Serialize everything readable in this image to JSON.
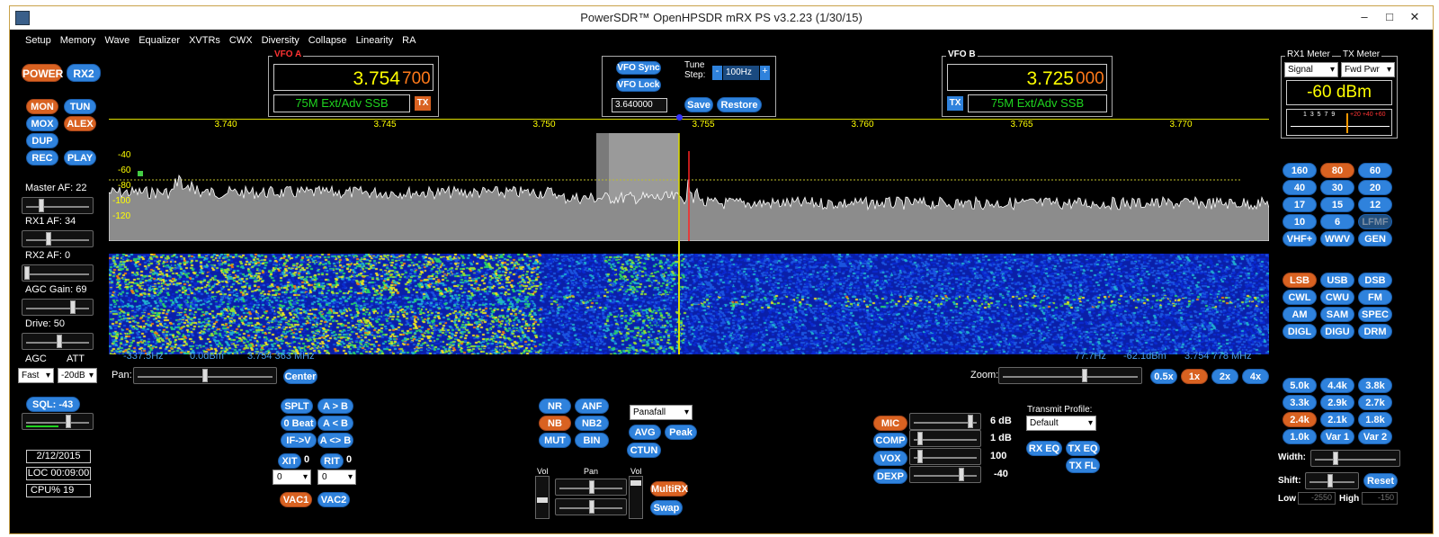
{
  "window": {
    "title": "PowerSDR™ OpenHPSDR mRX PS v3.2.23 (1/30/15)",
    "min": "–",
    "max": "□",
    "close": "✕"
  },
  "menu": [
    "Setup",
    "Memory",
    "Wave",
    "Equalizer",
    "XVTRs",
    "CWX",
    "Diversity",
    "Collapse",
    "Linearity",
    "RA"
  ],
  "left": {
    "power": "POWER",
    "rx2": "RX2",
    "mon": "MON",
    "tun": "TUN",
    "mox": "MOX",
    "alex": "ALEX",
    "dup": "DUP",
    "rec": "REC",
    "play": "PLAY",
    "master_af": "Master AF:  22",
    "rx1_af": "RX1 AF:  34",
    "rx2_af": "RX2 AF:  0",
    "agc_gain": "AGC Gain:  69",
    "drive": "Drive:  50",
    "agc": "AGC",
    "att": "ATT",
    "agc_val": "Fast",
    "att_val": "-20dB",
    "sql": "SQL:  -43",
    "date": "2/12/2015",
    "loc": "LOC 00:09:00",
    "cpu": "CPU%  19"
  },
  "vfo_a": {
    "title": "VFO A",
    "freq_main": "3.754",
    "freq_sub": "700",
    "mode": "75M Ext/Adv SSB",
    "tx": "TX"
  },
  "vfo_b": {
    "title": "VFO B",
    "freq_main": "3.725",
    "freq_sub": "000",
    "mode": "75M Ext/Adv SSB",
    "tx": "TX"
  },
  "center": {
    "vfo_sync": "VFO Sync",
    "vfo_lock": "VFO Lock",
    "tune_step": "Tune Step:",
    "minus": "-",
    "step": "100Hz",
    "plus": "+",
    "freq_input": "3.640000",
    "save": "Save",
    "restore": "Restore"
  },
  "panadapter": {
    "ticks": [
      "3.740",
      "3.745",
      "3.750",
      "3.755",
      "3.760",
      "3.765",
      "3.770"
    ],
    "db_labels": [
      "-40",
      "-60",
      "-80",
      "-100",
      "-120"
    ],
    "readout_left": [
      "-337.5Hz",
      "0.0dBm",
      "3.754 363 MHz"
    ],
    "readout_right": [
      "77.7Hz",
      "-62.1dBm",
      "3.754 778 MHz"
    ]
  },
  "pan": {
    "label": "Pan:",
    "center": "Center",
    "zoom": "Zoom:",
    "z05": "0.5x",
    "z1": "1x",
    "z2": "2x",
    "z4": "4x"
  },
  "bottom": {
    "splt": "SPLT",
    "atob": "A > B",
    "zerobeat": "0 Beat",
    "altb": "A < B",
    "ifv": "IF->V",
    "aswap": "A <> B",
    "xit": "XIT",
    "xit_val": "0",
    "rit": "RIT",
    "rit_val": "0",
    "xit_in": "0",
    "rit_in": "0",
    "vac1": "VAC1",
    "vac2": "VAC2",
    "nr": "NR",
    "anf": "ANF",
    "nb": "NB",
    "nb2": "NB2",
    "mut": "MUT",
    "bin": "BIN",
    "display_mode": "Panafall",
    "avg": "AVG",
    "peak": "Peak",
    "ctun": "CTUN",
    "vol": "Vol",
    "pan": "Pan",
    "vol2": "Vol",
    "multirx": "MultiRX",
    "swap": "Swap",
    "mic": "MIC",
    "mic_val": "6 dB",
    "comp": "COMP",
    "comp_val": "1 dB",
    "vox": "VOX",
    "vox_val": "100",
    "dexp": "DEXP",
    "dexp_val": "-40",
    "tx_profile": "Transmit Profile:",
    "profile_val": "Default",
    "rxeq": "RX EQ",
    "txeq": "TX EQ",
    "txfl": "TX FL"
  },
  "right": {
    "rx1_meter": "RX1 Meter",
    "tx_meter": "TX Meter",
    "rx1_sel": "Signal",
    "tx_sel": "Fwd Pwr",
    "dbm": "-60 dBm",
    "scale": "1 3 5 7 9",
    "scale_red": "+20 +40 +60",
    "bands": [
      "160",
      "80",
      "60",
      "40",
      "30",
      "20",
      "17",
      "15",
      "12",
      "10",
      "6",
      "LFMF",
      "VHF+",
      "WWV",
      "GEN"
    ],
    "modes": [
      "LSB",
      "USB",
      "DSB",
      "CWL",
      "CWU",
      "FM",
      "AM",
      "SAM",
      "SPEC",
      "DIGL",
      "DIGU",
      "DRM"
    ],
    "filters": [
      "5.0k",
      "4.4k",
      "3.8k",
      "3.3k",
      "2.9k",
      "2.7k",
      "2.4k",
      "2.1k",
      "1.8k",
      "1.0k",
      "Var 1",
      "Var 2"
    ],
    "width": "Width:",
    "shift": "Shift:",
    "reset": "Reset",
    "low": "Low",
    "low_val": "-2550",
    "high": "High",
    "high_val": "-150"
  },
  "colors": {
    "accent": "#2f82dc",
    "active": "#d96221",
    "freq_yellow": "#ffff00",
    "freq_orange": "#ff7a1a",
    "mode_green": "#1fd41f"
  }
}
